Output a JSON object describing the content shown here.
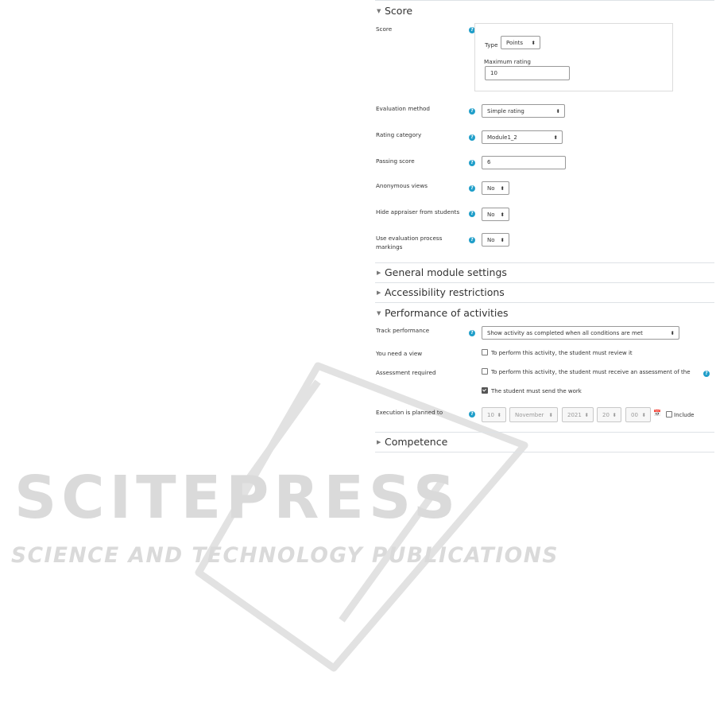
{
  "score_section": {
    "title": "Score",
    "score_label": "Score",
    "type_label": "Type",
    "type_value": "Points",
    "max_rating_label": "Maximum rating",
    "max_rating_value": "10",
    "evaluation_method_label": "Evaluation method",
    "evaluation_method_value": "Simple rating",
    "rating_category_label": "Rating category",
    "rating_category_value": "Module1_2",
    "passing_score_label": "Passing score",
    "passing_score_value": "6",
    "anonymous_views_label": "Anonymous views",
    "anonymous_views_value": "No",
    "hide_appraiser_label": "Hide appraiser from students",
    "hide_appraiser_value": "No",
    "use_markings_label_1": "Use evaluation process",
    "use_markings_label_2": "markings",
    "use_markings_value": "No"
  },
  "collapsed_sections": {
    "general": "General module settings",
    "accessibility": "Accessibility restrictions",
    "competence": "Competence"
  },
  "performance_section": {
    "title": "Performance of activities",
    "track_label": "Track performance",
    "track_value": "Show activity as completed when all conditions are met",
    "need_view_label": "You need a view",
    "need_view_text": "To perform this activity, the student must review it",
    "assessment_label": "Assessment required",
    "assessment_text": "To perform this activity, the student must receive an assessment of the",
    "send_work_text": "The student must send the work",
    "planned_label": "Execution is planned to",
    "day": "10",
    "month": "November",
    "year": "2021",
    "hour": "20",
    "minute": "00",
    "include_label": "Include"
  },
  "help_glyph": "?",
  "select_arrow_glyph": "⬍",
  "calendar_glyph": "📅",
  "watermark": {
    "line1": "SCITEPRESS",
    "line2": "SCIENCE AND TECHNOLOGY PUBLICATIONS"
  },
  "colors": {
    "help_icon": "#1f9ec9",
    "border": "#999999",
    "watermark": "#dcdcdc"
  }
}
